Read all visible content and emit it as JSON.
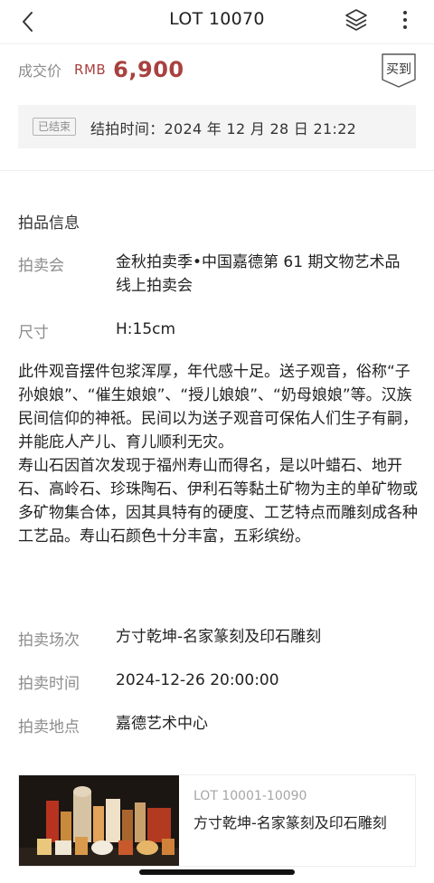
{
  "header": {
    "title": "LOT 10070",
    "back_icon": "chevron-left-icon",
    "layers_icon": "layers-icon",
    "more_icon": "more-vertical-icon"
  },
  "price": {
    "label": "成交价",
    "currency": "RMB",
    "value": "6,900",
    "color": "#a8413f",
    "badge": "买到"
  },
  "status": {
    "tag": "已结束",
    "text": "结拍时间：2024 年 12 月 28 日 21:22"
  },
  "info": {
    "section_title": "拍品信息",
    "auction_label": "拍卖会",
    "auction_value": "金秋拍卖季•中国嘉德第 61 期文物艺术品线上拍卖会",
    "size_label": "尺寸",
    "size_value": "H:15cm",
    "description_p1": "此件观音摆件包浆浑厚，年代感十足。送子观音，俗称“子孙娘娘”、“催生娘娘”、“授儿娘娘”、“奶母娘娘”等。汉族民间信仰的神祇。民间以为送子观音可保佑人们生子有嗣，并能庇人产儿、育儿顺利无灾。",
    "description_p2": "寿山石因首次发现于福州寿山而得名，是以叶蜡石、地开石、高岭石、珍珠陶石、伊利石等黏土矿物为主的单矿物或多矿物集合体，因其具特有的硬度、工艺特点而雕刻成各种工艺品。寿山石颜色十分丰富，五彩缤纷。",
    "session_label": "拍卖场次",
    "session_value": "方寸乾坤-名家篆刻及印石雕刻",
    "time_label": "拍卖时间",
    "time_value": "2024-12-26 20:00:00",
    "place_label": "拍卖地点",
    "place_value": "嘉德艺术中心"
  },
  "session_card": {
    "range": "LOT 10001-10090",
    "title": "方寸乾坤-名家篆刻及印石雕刻"
  }
}
